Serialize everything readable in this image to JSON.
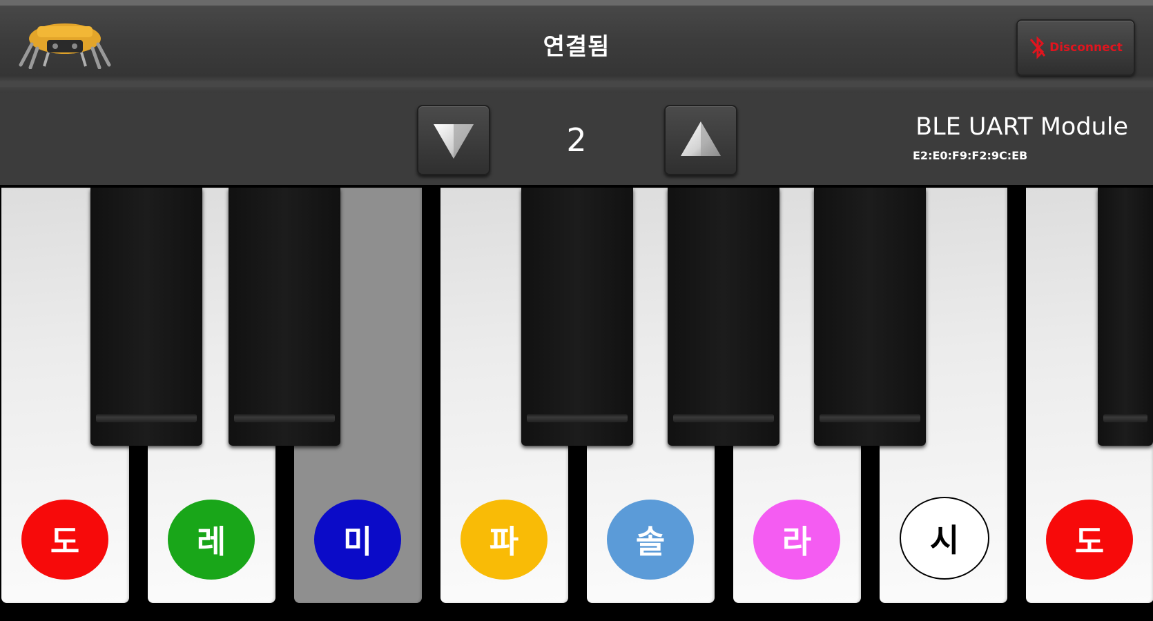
{
  "header": {
    "title": "연결됨",
    "disconnect_label": "Disconnect"
  },
  "controls": {
    "octave_value": "2",
    "device_name": "BLE UART Module",
    "device_address": "E2:E0:F9:F2:9C:EB"
  },
  "keys": [
    {
      "label": "도",
      "color": "#f70a0a"
    },
    {
      "label": "레",
      "color": "#19a619"
    },
    {
      "label": "미",
      "color": "#0b0bc8",
      "pressed": true
    },
    {
      "label": "파",
      "color": "#f9bb06"
    },
    {
      "label": "솔",
      "color": "#5b9bd8"
    },
    {
      "label": "라",
      "color": "#f45cf2"
    },
    {
      "label": "시",
      "color": "#ffffff"
    },
    {
      "label": "도",
      "color": "#f70a0a"
    }
  ],
  "colors": {
    "accent_red": "#e0141e",
    "bar_dark": "#3c3c3c"
  }
}
